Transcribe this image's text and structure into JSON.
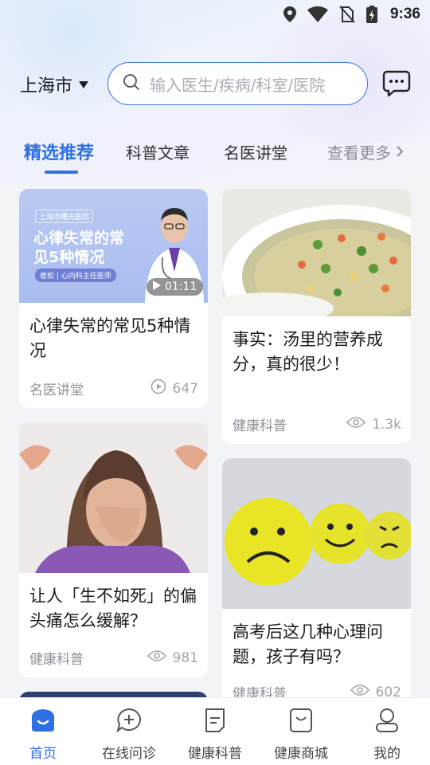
{
  "status_bar": {
    "time": "9:36"
  },
  "header": {
    "city": "上海市",
    "search_placeholder": "输入医生/疾病/科室/医院"
  },
  "tabs": [
    {
      "label": "精选推荐",
      "active": true
    },
    {
      "label": "科普文章",
      "active": false
    },
    {
      "label": "名医讲堂",
      "active": false
    }
  ],
  "more_label": "查看更多",
  "cards": [
    {
      "title": "心律失常的常见5种情况",
      "category": "名医讲堂",
      "count": "647",
      "count_icon": "play-icon",
      "thumb": {
        "hospital": "上海市曙光医院",
        "headline": "心律失常的常见5种情况",
        "doctor": "崔松 | 心内科主任医师",
        "duration": "01:11"
      }
    },
    {
      "title": "事实：汤里的营养成分，真的很少！",
      "category": "健康科普",
      "count": "1.3k",
      "count_icon": "eye-icon"
    },
    {
      "title": "让人「生不如死」的偏头痛怎么缓解？",
      "category": "健康科普",
      "count": "981",
      "count_icon": "eye-icon"
    },
    {
      "title": "高考后这几种心理问题，孩子有吗？",
      "category": "健康科普",
      "count": "602",
      "count_icon": "eye-icon"
    }
  ],
  "bottom_nav": [
    {
      "label": "首页",
      "icon": "home-icon",
      "active": true
    },
    {
      "label": "在线问诊",
      "icon": "chat-plus-icon",
      "active": false
    },
    {
      "label": "健康科普",
      "icon": "document-icon",
      "active": false
    },
    {
      "label": "健康商城",
      "icon": "shopping-bag-icon",
      "active": false
    },
    {
      "label": "我的",
      "icon": "profile-icon",
      "active": false
    }
  ],
  "colors": {
    "accent": "#2f6fe4",
    "background": "#f3f4f8"
  }
}
